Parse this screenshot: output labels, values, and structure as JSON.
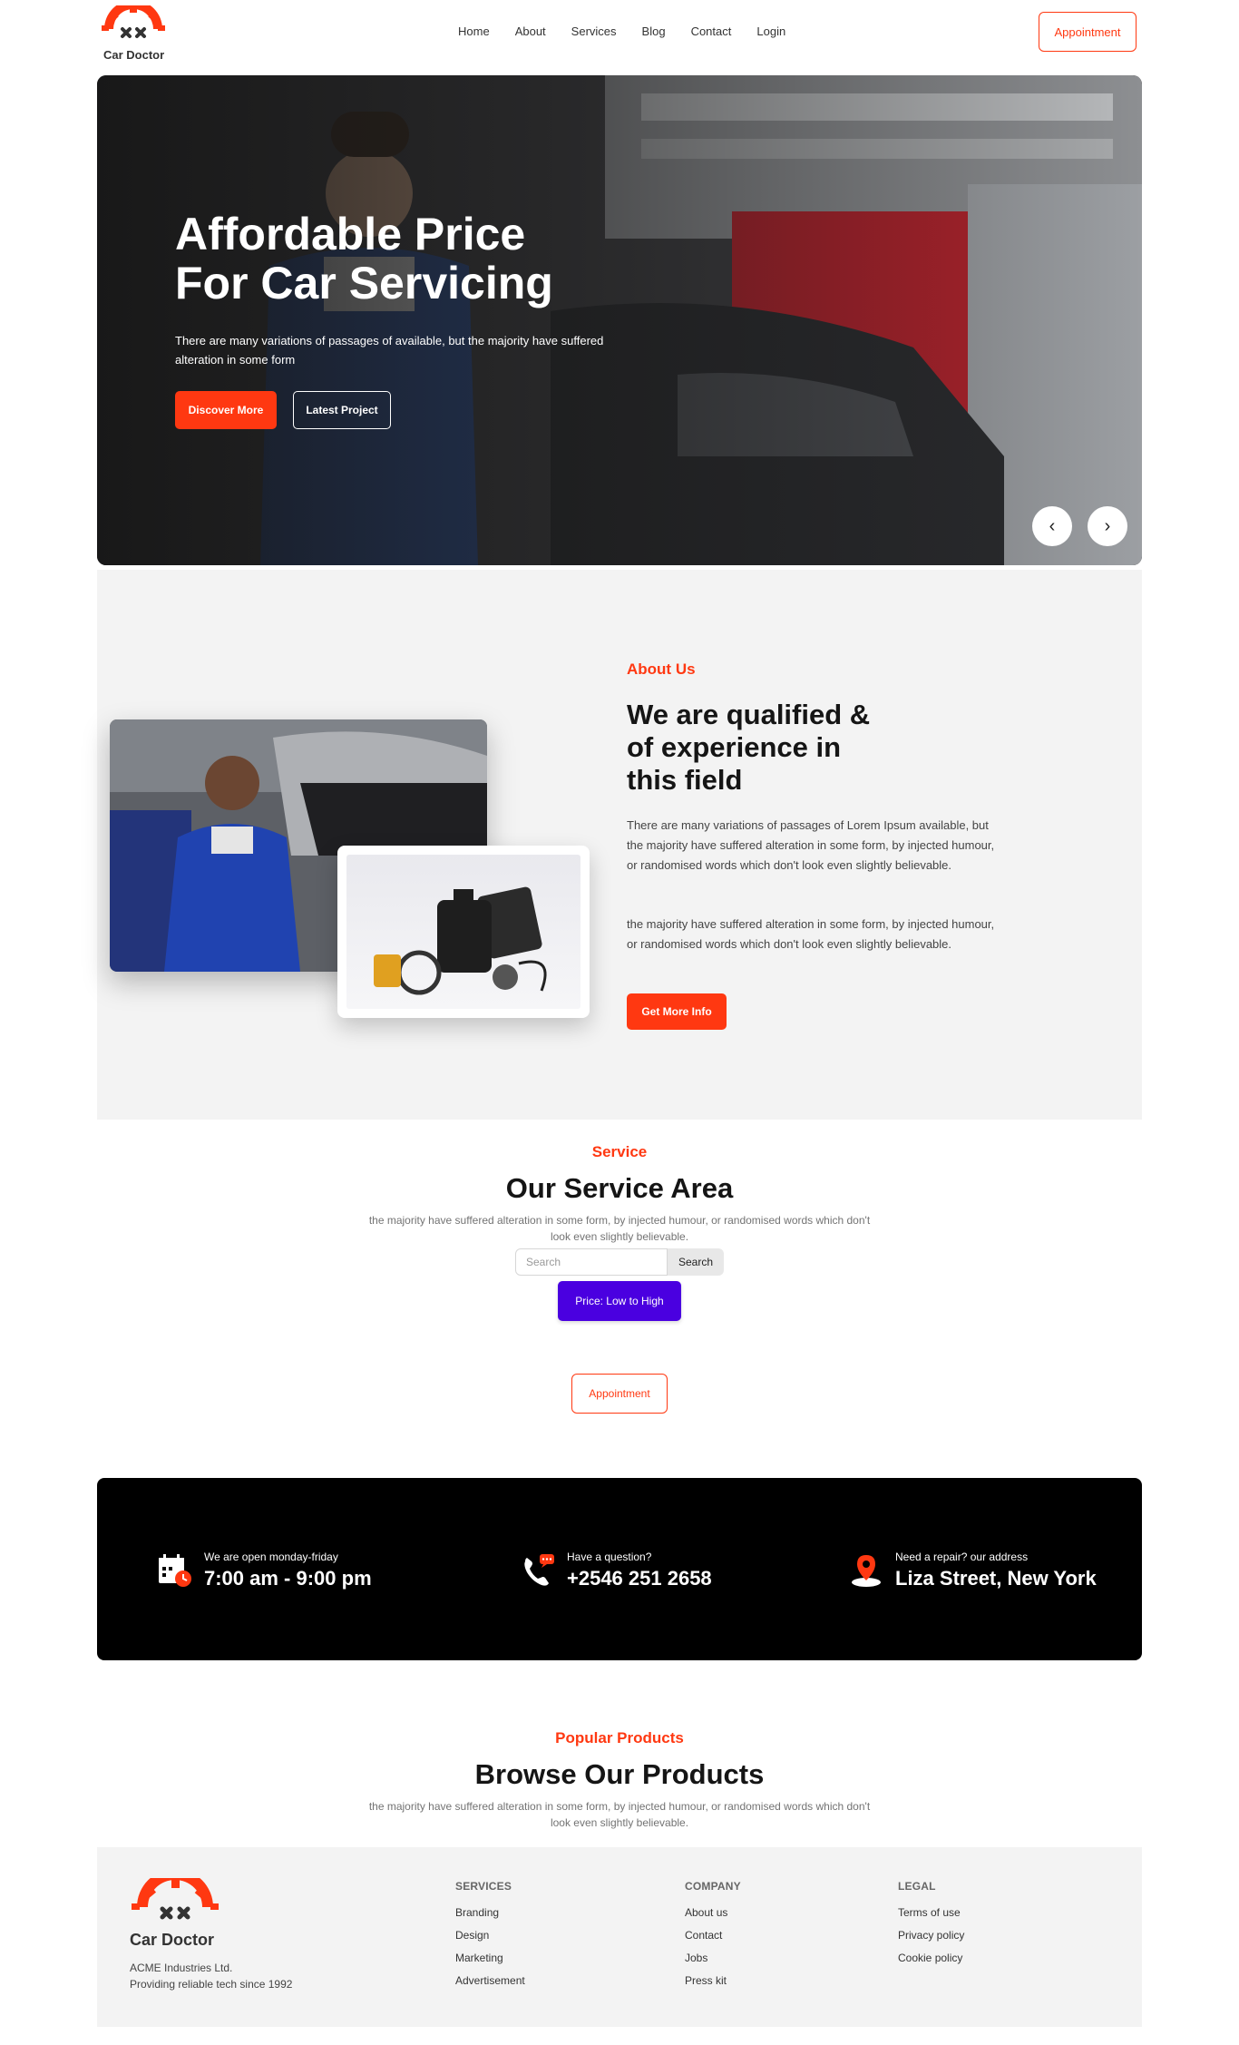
{
  "brand": {
    "name": "Car Doctor",
    "accent": "#FF3811",
    "dark": "#151515"
  },
  "nav": {
    "links": [
      "Home",
      "About",
      "Services",
      "Blog",
      "Contact",
      "Login"
    ],
    "appointment": "Appointment"
  },
  "hero": {
    "title_line1": "Affordable Price",
    "title_line2": "For Car Servicing",
    "text": "There are many variations of passages of available, but the majority have suffered alteration in some form",
    "discover": "Discover More",
    "latest": "Latest Project",
    "prev": "‹",
    "next": "›"
  },
  "about": {
    "subtitle": "About Us",
    "title": "We are qualified & of experience in this field",
    "p1": "There are many variations of passages of Lorem Ipsum available, but the majority have suffered alteration in some form, by injected humour, or randomised words which don't look even slightly believable.",
    "p2": "the majority have suffered alteration in some form, by injected humour, or randomised words which don't look even slightly believable.",
    "button": "Get More Info"
  },
  "service": {
    "subtitle": "Service",
    "title": "Our Service Area",
    "desc": "the majority have suffered alteration in some form, by injected humour, or randomised words which don't look even slightly believable.",
    "search_placeholder": "Search",
    "search_button": "Search",
    "sort_button": "Price: Low to High",
    "appointment": "Appointment"
  },
  "contact": {
    "hours_label": "We are open monday-friday",
    "hours_value": "7:00 am - 9:00 pm",
    "phone_label": "Have a question?",
    "phone_value": "+2546 251 2658",
    "address_label": "Need a repair? our address",
    "address_value": "Liza Street, New York"
  },
  "products": {
    "subtitle": "Popular Products",
    "title": "Browse Our Products",
    "desc": "the majority have suffered alteration in some form, by injected humour, or randomised words which don't look even slightly believable."
  },
  "footer": {
    "name": "Car Doctor",
    "company_line1": "ACME Industries Ltd.",
    "company_line2": "Providing reliable tech since 1992",
    "services": {
      "heading": "SERVICES",
      "links": [
        "Branding",
        "Design",
        "Marketing",
        "Advertisement"
      ]
    },
    "company": {
      "heading": "COMPANY",
      "links": [
        "About us",
        "Contact",
        "Jobs",
        "Press kit"
      ]
    },
    "legal": {
      "heading": "LEGAL",
      "links": [
        "Terms of use",
        "Privacy policy",
        "Cookie policy"
      ]
    }
  }
}
